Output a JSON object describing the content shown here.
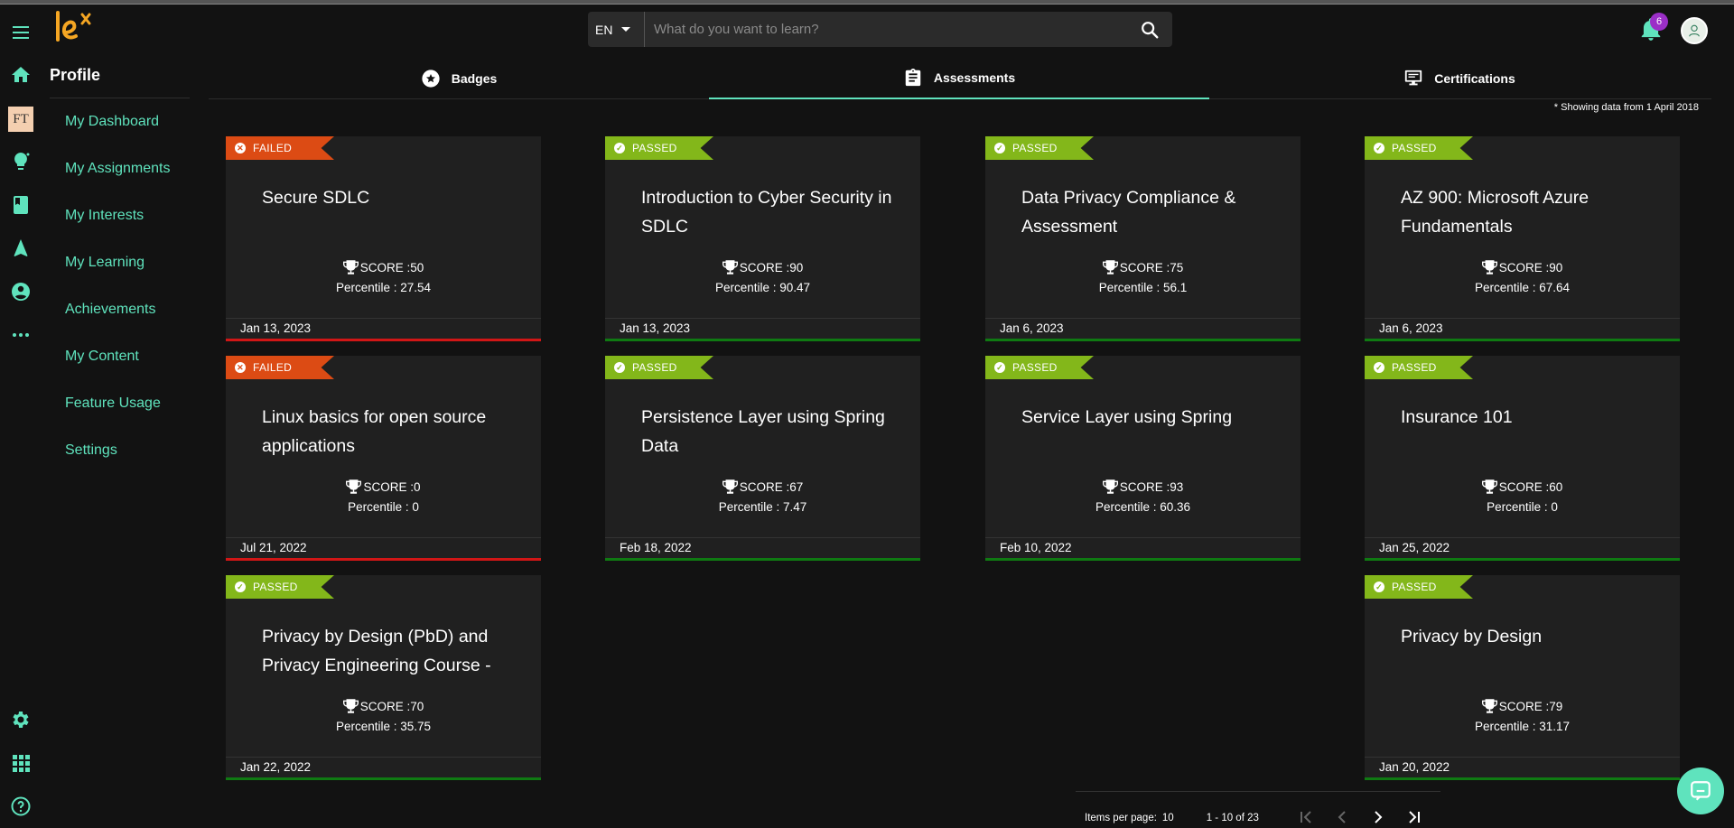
{
  "app": {
    "logo_text": "lex",
    "accent": "#5fe3bd"
  },
  "rail": {
    "icons": [
      "menu-icon",
      "home-icon",
      "ft-logo-icon",
      "lightbulb-icon",
      "book-icon",
      "navigation-icon",
      "account-icon",
      "more-icon",
      "settings-icon",
      "apps-icon",
      "help-icon"
    ],
    "ft_label": "FT"
  },
  "sidebar": {
    "title": "Profile",
    "items": [
      {
        "label": "My Dashboard"
      },
      {
        "label": "My Assignments"
      },
      {
        "label": "My Interests"
      },
      {
        "label": "My Learning"
      },
      {
        "label": "Achievements"
      },
      {
        "label": "My Content"
      },
      {
        "label": "Feature Usage"
      },
      {
        "label": "Settings"
      }
    ]
  },
  "header": {
    "language": "EN",
    "search_placeholder": "What do you want to learn?",
    "notifications_count": "6"
  },
  "tabs": [
    {
      "label": "Badges",
      "icon": "star-badge-icon"
    },
    {
      "label": "Assessments",
      "icon": "clipboard-icon",
      "active": true
    },
    {
      "label": "Certifications",
      "icon": "monitor-icon"
    }
  ],
  "note": "* Showing data from 1 April 2018",
  "colors": {
    "failed_ribbon": "#dc4b14",
    "passed_ribbon": "#83b71a",
    "failed_bar": "#d11616",
    "passed_bar": "#0f7a12",
    "badge": "#9b2fc7"
  },
  "cards": [
    {
      "status": "FAILED",
      "title": "Secure SDLC",
      "score": "SCORE :50",
      "percentile": "Percentile : 27.54",
      "date": "Jan 13, 2023"
    },
    {
      "status": "PASSED",
      "title": "Introduction to Cyber Security in SDLC",
      "score": "SCORE :90",
      "percentile": "Percentile : 90.47",
      "date": "Jan 13, 2023"
    },
    {
      "status": "PASSED",
      "title": "Data Privacy Compliance & Assessment",
      "score": "SCORE :75",
      "percentile": "Percentile : 56.1",
      "date": "Jan 6, 2023"
    },
    {
      "status": "PASSED",
      "title": "AZ 900: Microsoft Azure Fundamentals",
      "score": "SCORE :90",
      "percentile": "Percentile : 67.64",
      "date": "Jan 6, 2023"
    },
    {
      "status": "FAILED",
      "title": "Linux basics for open source applications",
      "score": "SCORE :0",
      "percentile": "Percentile : 0",
      "date": "Jul 21, 2022"
    },
    {
      "status": "PASSED",
      "title": "Persistence Layer using Spring Data",
      "score": "SCORE :67",
      "percentile": "Percentile : 7.47",
      "date": "Feb 18, 2022"
    },
    {
      "status": "PASSED",
      "title": "Service Layer using Spring",
      "score": "SCORE :93",
      "percentile": "Percentile : 60.36",
      "date": "Feb 10, 2022"
    },
    {
      "status": "PASSED",
      "title": "Insurance 101",
      "score": "SCORE :60",
      "percentile": "Percentile : 0",
      "date": "Jan 25, 2022"
    },
    {
      "status": "PASSED",
      "title": "Privacy by Design (PbD) and Privacy Engineering Course -",
      "score": "SCORE :70",
      "percentile": "Percentile : 35.75",
      "date": "Jan 22, 2022"
    },
    {
      "status": "PASSED",
      "title": "Privacy by Design",
      "score": "SCORE :79",
      "percentile": "Percentile : 31.17",
      "date": "Jan 20, 2022"
    }
  ],
  "paginator": {
    "items_per_page_label": "Items per page:",
    "items_per_page": "10",
    "range": "1 - 10 of 23"
  }
}
